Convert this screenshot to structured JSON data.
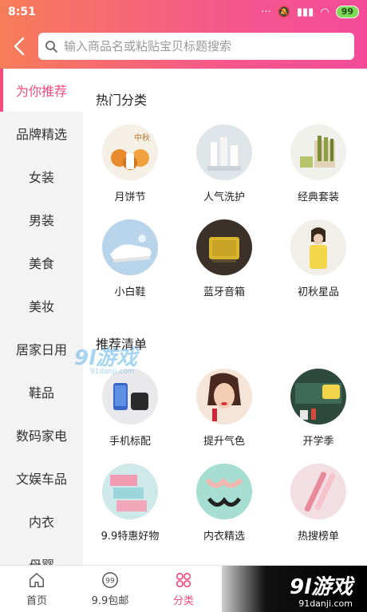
{
  "status_bar": {
    "time": "8:51",
    "battery": "99"
  },
  "header": {
    "search_placeholder": "输入商品名或粘贴宝贝标题搜索"
  },
  "sidebar": {
    "items": [
      {
        "label": "为你推荐",
        "active": true
      },
      {
        "label": "品牌精选"
      },
      {
        "label": "女装"
      },
      {
        "label": "男装"
      },
      {
        "label": "美食"
      },
      {
        "label": "美妆"
      },
      {
        "label": "居家日用"
      },
      {
        "label": "鞋品"
      },
      {
        "label": "数码家电"
      },
      {
        "label": "文娱车品"
      },
      {
        "label": "内衣"
      },
      {
        "label": "母婴"
      }
    ]
  },
  "main": {
    "hot_title": "热门分类",
    "hot_items": [
      {
        "label": "月饼节",
        "icon": "mooncake-photo"
      },
      {
        "label": "人气洗护",
        "icon": "skincare-bottles-photo"
      },
      {
        "label": "经典套装",
        "icon": "gift-set-photo"
      },
      {
        "label": "小白鞋",
        "icon": "white-sneaker-photo"
      },
      {
        "label": "蓝牙音箱",
        "icon": "bluetooth-speaker-photo"
      },
      {
        "label": "初秋星品",
        "icon": "autumn-fashion-photo"
      }
    ],
    "rec_title": "推荐清单",
    "rec_items": [
      {
        "label": "手机标配",
        "icon": "phone-accessory-photo"
      },
      {
        "label": "提升气色",
        "icon": "makeup-model-photo"
      },
      {
        "label": "开学季",
        "icon": "back-to-school-photo"
      },
      {
        "label": "9.9特惠好物",
        "icon": "tissue-pack-photo"
      },
      {
        "label": "内衣精选",
        "icon": "lingerie-photo"
      },
      {
        "label": "热搜榜单",
        "icon": "electric-toothbrush-photo"
      }
    ]
  },
  "watermark": {
    "text": "9l游戏",
    "sub": "91danji.com"
  },
  "bottom_nav": {
    "items": [
      {
        "label": "首页",
        "icon": "home-icon"
      },
      {
        "label": "9.9包邮",
        "icon": "nine-nine-icon"
      },
      {
        "label": "分类",
        "icon": "category-icon",
        "active": true
      }
    ]
  },
  "corner_logo": {
    "big": "9l游戏",
    "small": "91danji.com"
  },
  "colors": {
    "accent": "#f34b7d",
    "gradient_start": "#f77d59",
    "gradient_end": "#f34b9a"
  }
}
